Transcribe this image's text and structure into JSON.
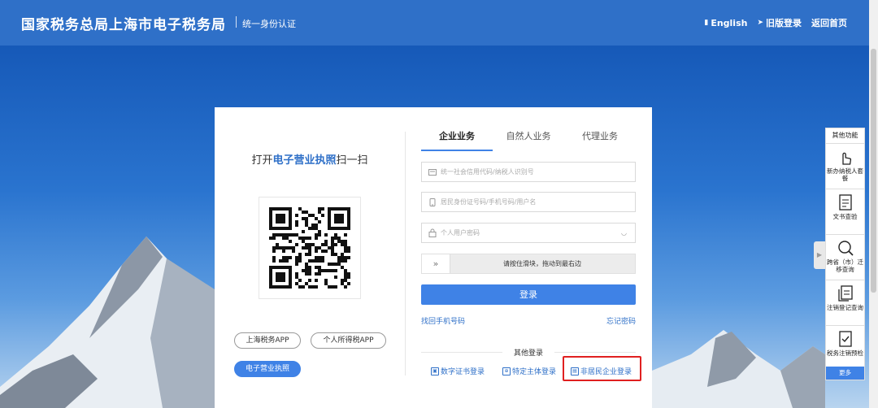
{
  "header": {
    "title": "国家税务总局上海市电子税务局",
    "subtitle": "统一身份认证",
    "links": {
      "english": "English",
      "old_version": "旧版登录",
      "home": "返回首页"
    }
  },
  "qr_panel": {
    "title_prefix": "打开",
    "title_highlight": "电子营业执照",
    "title_suffix": "扫一扫",
    "pills": [
      "上海税务APP",
      "个人所得税APP",
      "电子营业执照"
    ],
    "active_pill": "电子营业执照"
  },
  "login": {
    "tabs": [
      "企业业务",
      "自然人业务",
      "代理业务"
    ],
    "active_tab": "企业业务",
    "fields": {
      "credit_code_placeholder": "统一社会信用代码/纳税人识别号",
      "id_placeholder": "居民身份证号码/手机号码/用户名",
      "password_placeholder": "个人用户密码"
    },
    "slider_text": "请按住滑块，拖动到最右边",
    "submit": "登录",
    "find_phone": "找回手机号码",
    "forgot_password": "忘记密码",
    "other_title": "其他登录",
    "other_options": [
      "数字证书登录",
      "特定主体登录",
      "非居民企业登录"
    ]
  },
  "side_panel": {
    "title": "其他功能",
    "items": [
      "新办纳税人套餐",
      "文书查验",
      "跨省（市）迁移查询",
      "注销登记查询",
      "税务注销预检"
    ],
    "more": "更多"
  }
}
